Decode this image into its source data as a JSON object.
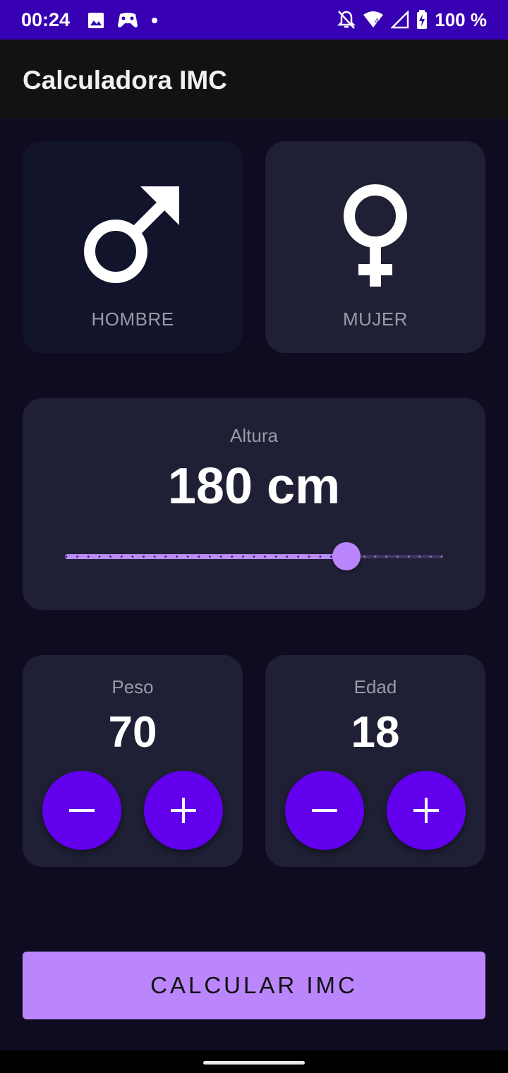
{
  "status_bar": {
    "time": "00:24",
    "battery": "100 %",
    "icons": [
      "image-icon",
      "game-controller-icon",
      "notification-dot-icon",
      "do-not-disturb-off-icon",
      "wifi-icon",
      "signal-icon",
      "battery-charging-icon"
    ]
  },
  "app_bar": {
    "title": "Calculadora IMC"
  },
  "gender": {
    "male_label": "HOMBRE",
    "female_label": "MUJER"
  },
  "height": {
    "label": "Altura",
    "value_text": "180 cm",
    "slider_fraction": 0.745
  },
  "weight": {
    "label": "Peso",
    "value": "70"
  },
  "age": {
    "label": "Edad",
    "value": "18"
  },
  "calculate_button": {
    "label": "CALCULAR IMC"
  },
  "colors": {
    "status_bar": "#3700b3",
    "accent": "#bb86fc",
    "button": "#6200ee",
    "card": "#1f2035",
    "card_selected": "#12142b",
    "background": "#0f0c22"
  }
}
